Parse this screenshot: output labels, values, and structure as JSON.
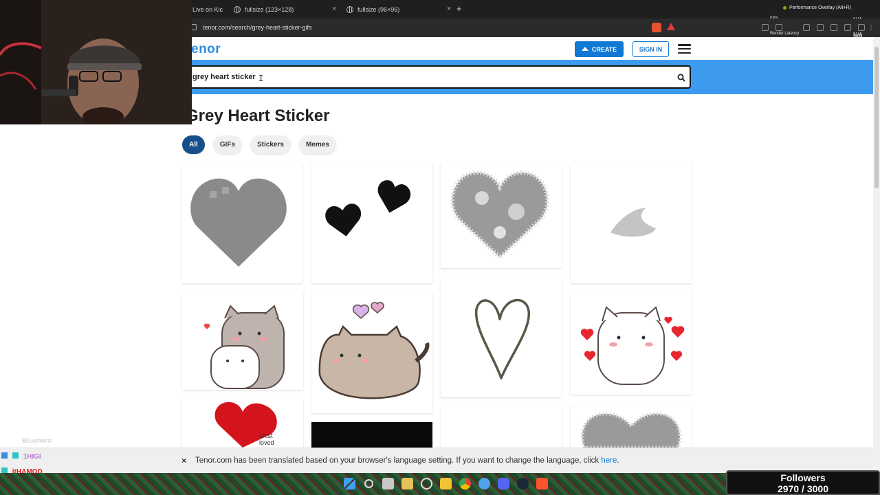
{
  "browser": {
    "tabs": [
      {
        "label": "Live on Kic"
      },
      {
        "label": "fullsize (123×128)"
      },
      {
        "label": "fullsize (96×96)"
      }
    ],
    "new_tab": "+",
    "url": "tenor.com/search/grey-heart-sticker-gifs"
  },
  "overlay": {
    "performance": "Performance Overlay (Alt+R)",
    "fps_label": "FPS",
    "fps_value": "N/A",
    "latency_label": "Render Latency",
    "latency_value": "N/A",
    "extra_value": "N/A"
  },
  "header": {
    "logo": "enor",
    "create_label": "CREATE",
    "signin_label": "SIGN IN"
  },
  "search": {
    "value": "grey heart sticker"
  },
  "page": {
    "title": "Grey Heart Sticker",
    "filters": [
      {
        "label": "All",
        "active": true
      },
      {
        "label": "GIFs",
        "active": false
      },
      {
        "label": "Stickers",
        "active": false
      },
      {
        "label": "Memes",
        "active": false
      }
    ]
  },
  "results": {
    "tile_texts": {
      "artist_line1": "artist",
      "artist_line2": "loved"
    }
  },
  "notification": {
    "close": "×",
    "text": "Tenor.com has been translated based on your browser's language setting. If you want to change the language, click ",
    "link": "here",
    "end": "."
  },
  "chat": {
    "line1_user": "Bluenero",
    "line2_user": "1HIGI",
    "line3_user": "itHAMOD"
  },
  "followers": {
    "label": "Followers",
    "count": "2970 / 3000"
  },
  "colors": {
    "accent": "#1178d3",
    "search_band": "#3c9bef",
    "active_pill": "#174f8c"
  }
}
